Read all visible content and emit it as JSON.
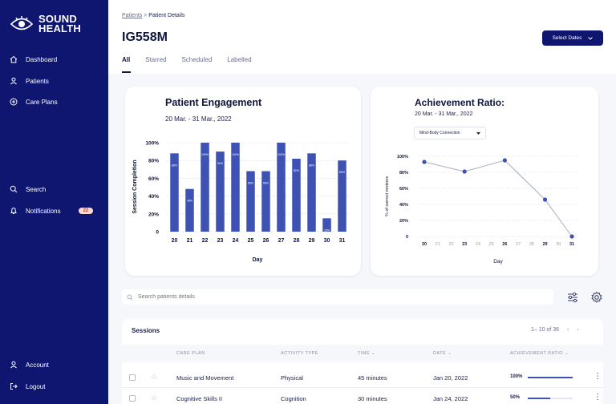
{
  "app": {
    "name_line1": "SOUND",
    "name_line2": "HEALTH"
  },
  "sidebar": {
    "items": [
      {
        "label": "Dashboard",
        "icon": "home-icon"
      },
      {
        "label": "Patients",
        "icon": "user-icon"
      },
      {
        "label": "Care Plans",
        "icon": "plus-circle-icon"
      },
      {
        "label": "Search",
        "icon": "search-icon"
      },
      {
        "label": "Notifications",
        "icon": "bell-icon",
        "badge": "22"
      },
      {
        "label": "Account",
        "icon": "user-icon"
      },
      {
        "label": "Logout",
        "icon": "logout-icon"
      }
    ]
  },
  "header": {
    "breadcrumb": {
      "parent": "Patients",
      "separator": ">",
      "current": "Patient Details"
    },
    "title": "IG558M",
    "select_dates": "Select Dates",
    "tabs": [
      "All",
      "Starred",
      "Scheduled",
      "Labelled"
    ]
  },
  "engagement": {
    "title": "Patient Engagement",
    "date_range": "20 Mar. - 31 Mar., 2022"
  },
  "achievement": {
    "title": "Achievement Ratio:",
    "date_range": "20 Mar. - 31 Mar., 2022",
    "dropdown_value": "Mind-Body Connection"
  },
  "chart_data": [
    {
      "type": "bar",
      "title": "Patient Engagement",
      "xlabel": "Day",
      "ylabel": "Session Completion",
      "categories": [
        "20",
        "21",
        "22",
        "23",
        "24",
        "25",
        "26",
        "27",
        "28",
        "29",
        "30",
        "31"
      ],
      "values": [
        88,
        48,
        100,
        90,
        100,
        68,
        68,
        100,
        82,
        88,
        15,
        80
      ],
      "yticks": [
        "0",
        "20%",
        "40%",
        "60%",
        "80%",
        "100%"
      ],
      "ylim": [
        0,
        100
      ],
      "grid": true,
      "color": "#3e52b4"
    },
    {
      "type": "line",
      "title": "Achievement Ratio:",
      "xlabel": "Day",
      "ylabel": "% of correct motions",
      "x": [
        "20",
        "21",
        "22",
        "23",
        "24",
        "25",
        "26",
        "27",
        "28",
        "29",
        "30",
        "31"
      ],
      "bold_x": [
        "20",
        "23",
        "26",
        "29",
        "31"
      ],
      "points": [
        {
          "x": "20",
          "y": 93
        },
        {
          "x": "23",
          "y": 81
        },
        {
          "x": "26",
          "y": 95
        },
        {
          "x": "29",
          "y": 46
        },
        {
          "x": "31",
          "y": 0
        }
      ],
      "yticks": [
        "0",
        "20%",
        "40%",
        "60%",
        "80%",
        "100%"
      ],
      "ylim": [
        0,
        100
      ],
      "grid": true,
      "color": "#3e52b4"
    }
  ],
  "search": {
    "placeholder": "Search patients details"
  },
  "sessions": {
    "title": "Sessions",
    "pager": "1– 10 of 36",
    "columns": [
      "CARE PLAN",
      "ACTIVITY TYPE",
      "TIME",
      "DATE",
      "ACHIEVEMENT RATIO"
    ],
    "rows": [
      {
        "care_plan": "Music and Movement",
        "activity": "Physical",
        "time": "45 minutes",
        "date": "Jan 20, 2022",
        "ratio_label": "100%",
        "ratio": 1.0
      },
      {
        "care_plan": "Cognitive Skills II",
        "activity": "Cognition",
        "time": "30 minutes",
        "date": "Jan 24, 2022",
        "ratio_label": "50%",
        "ratio": 0.5
      }
    ]
  },
  "colors": {
    "sidebar": "#0f1670",
    "accent": "#3e52b4",
    "badge_bg": "#ffd7d1",
    "badge_text": "#d23a2a"
  }
}
